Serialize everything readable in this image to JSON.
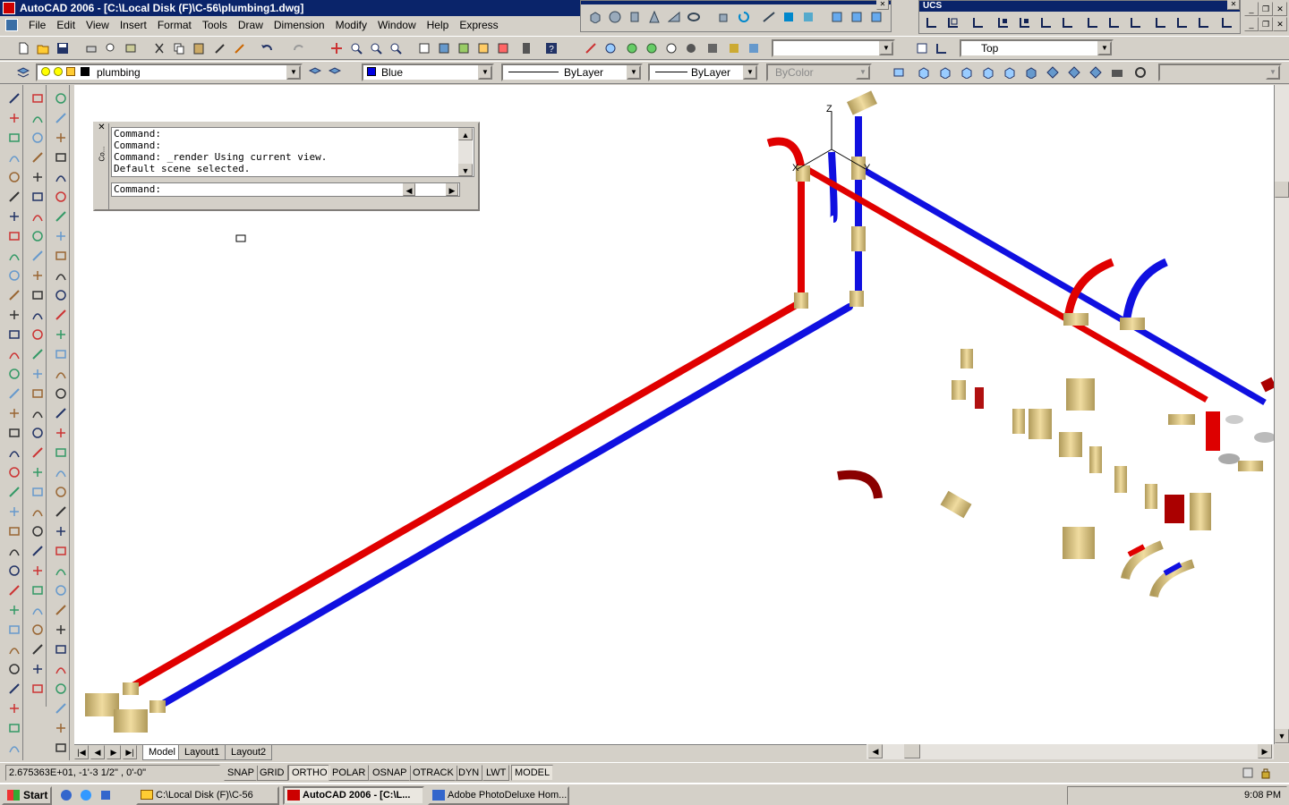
{
  "window": {
    "title": "AutoCAD 2006 - [C:\\Local Disk (F)\\C-56\\plumbing1.dwg]"
  },
  "menu": [
    "File",
    "Edit",
    "View",
    "Insert",
    "Format",
    "Tools",
    "Draw",
    "Dimension",
    "Modify",
    "Window",
    "Help",
    "Express"
  ],
  "floating_toolbars": {
    "ucs_title": "UCS"
  },
  "view_combo": {
    "value": "Top"
  },
  "layer_combo": {
    "value": "plumbing"
  },
  "color_combo": {
    "value": "Blue"
  },
  "linetype_combo": {
    "value": "ByLayer"
  },
  "lineweight_combo": {
    "value": "ByLayer"
  },
  "plotstyle_combo": {
    "value": "ByColor"
  },
  "command_window": {
    "history": [
      "Command:",
      "Command:",
      "Command: _render Using current view.",
      "Default scene selected."
    ],
    "prompt": "Command:",
    "side_label": "Co..."
  },
  "ucs_labels": {
    "z": "Z",
    "x": "X",
    "y": "Y"
  },
  "layout_tabs": [
    "Model",
    "Layout1",
    "Layout2"
  ],
  "status": {
    "coordinates": "2.675363E+01, -1'-3 1/2\" , 0'-0\"",
    "toggles": [
      "SNAP",
      "GRID",
      "ORTHO",
      "POLAR",
      "OSNAP",
      "OTRACK",
      "DYN",
      "LWT",
      "MODEL"
    ]
  },
  "taskbar": {
    "start": "Start",
    "tasks": [
      "C:\\Local Disk (F)\\C-56",
      "AutoCAD 2006 - [C:\\L...",
      "Adobe PhotoDeluxe Hom..."
    ],
    "clock": "9:08 PM"
  },
  "colors": {
    "hot_pipe": "#e00000",
    "cold_pipe": "#1010e0",
    "fitting": "#e8d090",
    "titlebar": "#0a246a"
  }
}
